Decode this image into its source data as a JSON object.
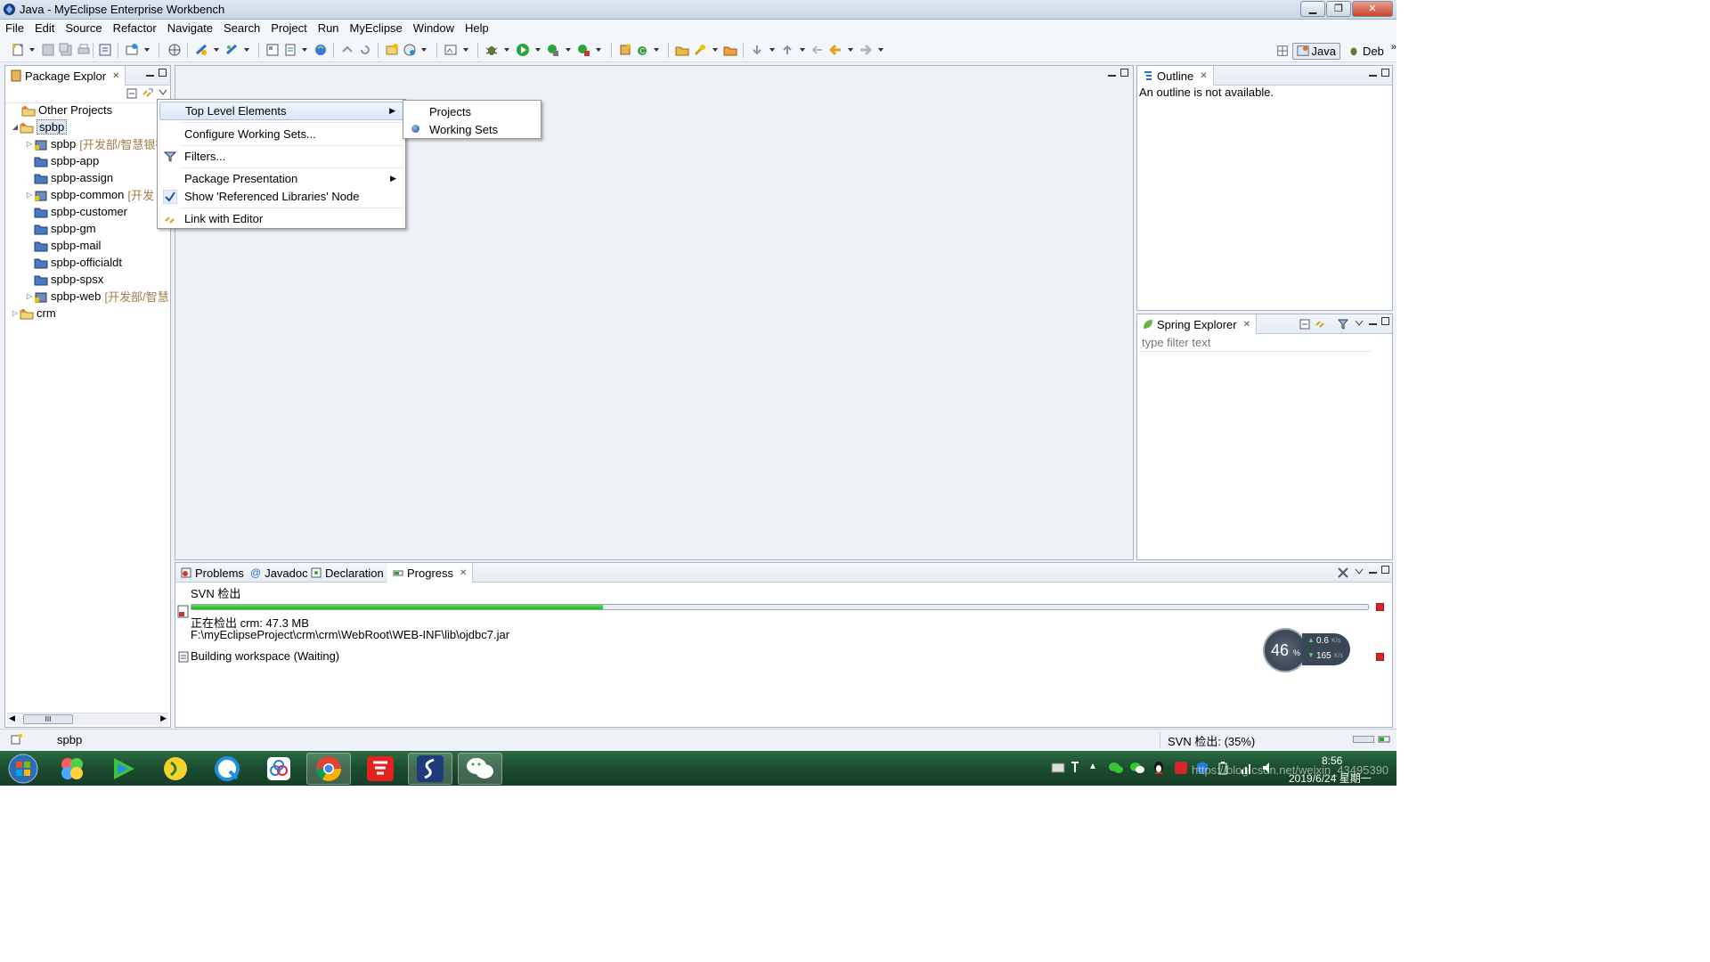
{
  "window": {
    "title": "Java - MyEclipse Enterprise Workbench"
  },
  "menu": [
    "File",
    "Edit",
    "Source",
    "Refactor",
    "Navigate",
    "Search",
    "Project",
    "Run",
    "MyEclipse",
    "Window",
    "Help"
  ],
  "perspectives": {
    "java": "Java",
    "debug": "Deb"
  },
  "package_explorer": {
    "tab_label": "Package Explor",
    "tree": [
      {
        "label": "Other Projects",
        "decor": ""
      },
      {
        "label": "spbp",
        "decor": ""
      },
      {
        "label": "spbp",
        "decor": "[开发部/智慧银行"
      },
      {
        "label": "spbp-app",
        "decor": ""
      },
      {
        "label": "spbp-assign",
        "decor": ""
      },
      {
        "label": "spbp-common",
        "decor": "[开发"
      },
      {
        "label": "spbp-customer",
        "decor": ""
      },
      {
        "label": "spbp-gm",
        "decor": ""
      },
      {
        "label": "spbp-mail",
        "decor": ""
      },
      {
        "label": "spbp-officialdt",
        "decor": ""
      },
      {
        "label": "spbp-spsx",
        "decor": ""
      },
      {
        "label": "spbp-web",
        "decor": "[开发部/智慧"
      },
      {
        "label": "crm",
        "decor": ""
      }
    ],
    "hscroll_label": "III"
  },
  "context_menu": {
    "top_level": "Top Level Elements",
    "configure": "Configure Working Sets...",
    "filters": "Filters...",
    "package_presentation": "Package Presentation",
    "show_ref_libs": "Show 'Referenced Libraries' Node",
    "link_editor": "Link with Editor"
  },
  "submenu": {
    "projects": "Projects",
    "working_sets": "Working Sets"
  },
  "outline": {
    "tab_label": "Outline",
    "message": "An outline is not available."
  },
  "spring_explorer": {
    "tab_label": "Spring Explorer",
    "filter_placeholder": "type filter text"
  },
  "bottom_tabs": {
    "problems": "Problems",
    "javadoc": "Javadoc",
    "declaration": "Declaration",
    "progress": "Progress"
  },
  "progress": {
    "job1_name": "SVN 检出",
    "job1_percent": 35,
    "job1_detail1": "正在检出 crm: 47.3 MB",
    "job1_detail2": "F:\\myEclipseProject\\crm\\crm\\WebRoot\\WEB-INF\\lib\\ojdbc7.jar",
    "job2": "Building workspace (Waiting)"
  },
  "net_gadget": {
    "percent": "46",
    "pct_sign": "%",
    "up": "0.6",
    "down": "165",
    "unit": "K/s"
  },
  "status": {
    "selection": "spbp",
    "job": "SVN 检出: (35%)"
  },
  "taskbar": {
    "time": "8:56",
    "date": "2019/6/24 星期一",
    "watermark": "https://blog.csdn.net/weixin_43495390"
  }
}
